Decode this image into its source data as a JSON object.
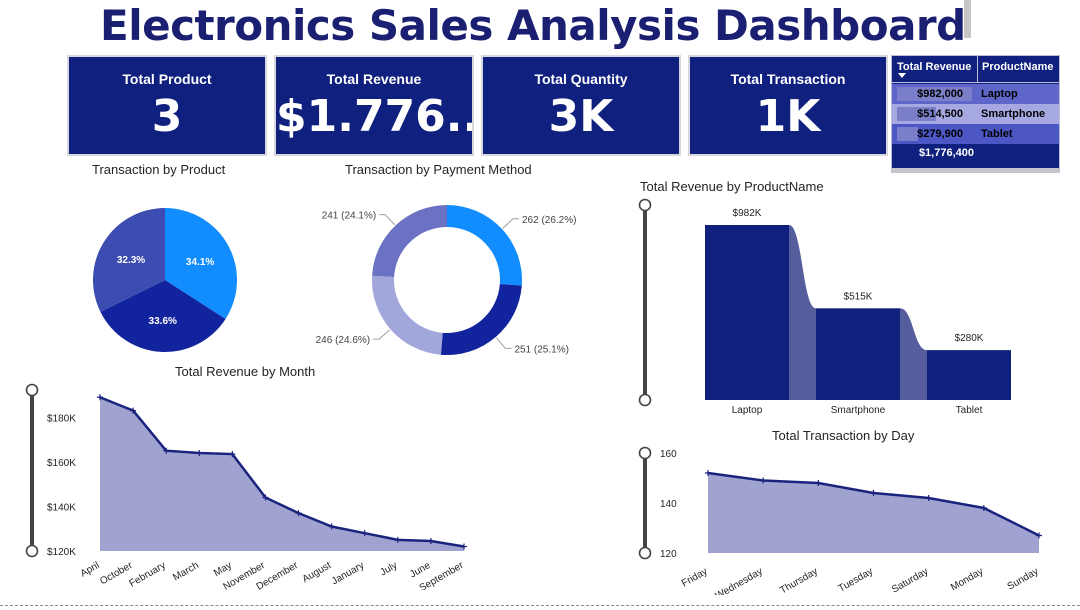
{
  "dashboard": {
    "title": "Electronics Sales Analysis Dashboard"
  },
  "kpis": [
    {
      "label": "Total Product",
      "value": "3"
    },
    {
      "label": "Total Revenue",
      "value": "$1.776..."
    },
    {
      "label": "Total Quantity",
      "value": "3K"
    },
    {
      "label": "Total Transaction",
      "value": "1K"
    }
  ],
  "product_table": {
    "headers": [
      "Total Revenue",
      "ProductName"
    ],
    "rows": [
      {
        "revenue": "$982,000",
        "name": "Laptop",
        "share": 1.0,
        "row_color": "#5e67c9"
      },
      {
        "revenue": "$514,500",
        "name": "Smartphone",
        "share": 0.524,
        "row_color": "#a6a8e2"
      },
      {
        "revenue": "$279,900",
        "name": "Tablet",
        "share": 0.285,
        "row_color": "#4c56c4"
      }
    ],
    "total": "$1,776,400"
  },
  "chart_titles": {
    "by_product": "Transaction by Product",
    "by_payment": "Transaction by Payment Method",
    "by_productname": "Total Revenue by ProductName",
    "by_month": "Total Revenue by Month",
    "by_day": "Total Transaction by Day"
  },
  "chart_data": [
    {
      "id": "pie_product",
      "type": "pie",
      "values": [
        34.1,
        33.6,
        32.3
      ],
      "labels": [
        "34.1%",
        "33.6%",
        "32.3%"
      ],
      "colors": [
        "#118dff",
        "#12239e",
        "#3d4cb0"
      ]
    },
    {
      "id": "donut_payment",
      "type": "pie",
      "values": [
        262,
        251,
        246,
        241
      ],
      "labels": [
        "262 (26.2%)",
        "251 (25.1%)",
        "246 (24.6%)",
        "241 (24.1%)"
      ],
      "colors": [
        "#118dff",
        "#12239e",
        "#a2a7db",
        "#6b72c3"
      ]
    },
    {
      "id": "ribbon_productname",
      "type": "bar",
      "categories": [
        "Laptop",
        "Smartphone",
        "Tablet"
      ],
      "values": [
        982000,
        514500,
        279900
      ],
      "data_labels": [
        "$982K",
        "$515K",
        "$280K"
      ],
      "bar_color": "#10207e",
      "ribbon_color": "#555d9d",
      "ylim": [
        0,
        982000
      ]
    },
    {
      "id": "area_month",
      "type": "area",
      "x": [
        "April",
        "October",
        "February",
        "March",
        "May",
        "November",
        "December",
        "August",
        "January",
        "July",
        "June",
        "September"
      ],
      "values": [
        189000,
        183000,
        165000,
        164000,
        163500,
        144000,
        137000,
        131000,
        128000,
        125000,
        124500,
        122000
      ],
      "ylim": [
        120000,
        190000
      ],
      "yticks": [
        120000,
        140000,
        160000,
        180000
      ],
      "ytick_labels": [
        "$120K",
        "$140K",
        "$160K",
        "$180K"
      ],
      "line_color": "#1a237e",
      "fill_color": "#a0a3cf"
    },
    {
      "id": "area_day",
      "type": "area",
      "x": [
        "Friday",
        "Wednesday",
        "Thursday",
        "Tuesday",
        "Saturday",
        "Monday",
        "Sunday"
      ],
      "values": [
        152,
        149,
        148,
        144,
        142,
        138,
        127
      ],
      "ylim": [
        120,
        160
      ],
      "yticks": [
        120,
        140,
        160
      ],
      "ytick_labels": [
        "120",
        "140",
        "160"
      ],
      "line_color": "#1a237e",
      "fill_color": "#a0a3cf"
    }
  ]
}
